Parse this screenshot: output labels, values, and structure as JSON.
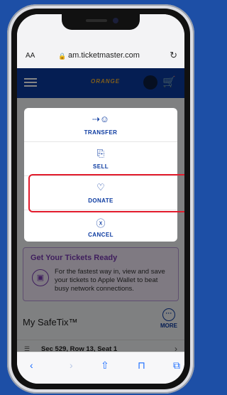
{
  "browser": {
    "text_size_label": "AA",
    "url": "am.ticketmaster.com",
    "reload_icon": "reload-icon"
  },
  "site": {
    "logo_text": "ORANGE",
    "menu_icon": "menu-icon",
    "cart_icon": "cart-icon"
  },
  "action_sheet": {
    "items": [
      {
        "label": "TRANSFER",
        "icon": "transfer-icon"
      },
      {
        "label": "SELL",
        "icon": "sell-icon"
      },
      {
        "label": "DONATE",
        "icon": "donate-icon"
      },
      {
        "label": "CANCEL",
        "icon": "cancel-icon"
      }
    ],
    "highlight_color": "#e21b2c"
  },
  "ready_card": {
    "title": "Get Your Tickets Ready",
    "body": "For the fastest way in, view and save your tickets to Apple Wallet to beat busy network connections."
  },
  "safetix": {
    "title": "My SafeTix™",
    "more_label": "MORE",
    "rows": [
      {
        "label": "Sec 529, Row 13, Seat 1"
      }
    ]
  },
  "toolbar": {
    "buttons": [
      "back-icon",
      "forward-icon",
      "share-icon",
      "bookmarks-icon",
      "tabs-icon"
    ]
  },
  "colors": {
    "brand_blue": "#0b3aa0",
    "background_blue": "#1d4fa6",
    "accent_purple": "#7a3bb3"
  }
}
